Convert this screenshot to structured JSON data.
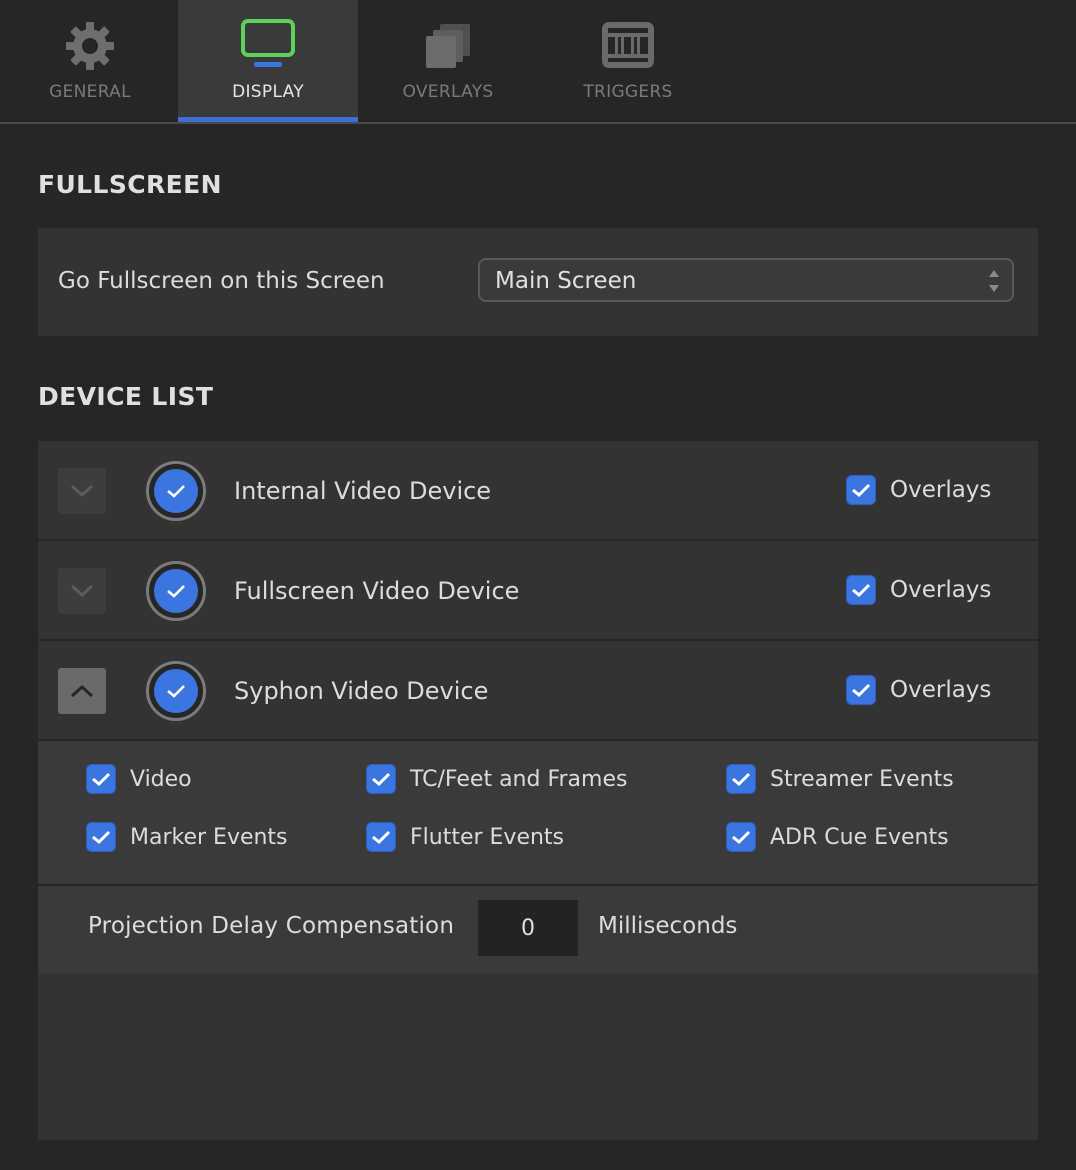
{
  "tabs": [
    {
      "label": "GENERAL",
      "icon": "gear-icon"
    },
    {
      "label": "DISPLAY",
      "icon": "monitor-icon",
      "active": true
    },
    {
      "label": "OVERLAYS",
      "icon": "layers-icon"
    },
    {
      "label": "TRIGGERS",
      "icon": "midi-icon"
    }
  ],
  "fullscreen": {
    "title": "FULLSCREEN",
    "label": "Go Fullscreen on this Screen",
    "selected_screen": "Main Screen"
  },
  "device_list": {
    "title": "DEVICE LIST",
    "devices": [
      {
        "name": "Internal Video Device",
        "enabled": true,
        "overlays_label": "Overlays",
        "overlays": true,
        "expanded": false
      },
      {
        "name": "Fullscreen Video Device",
        "enabled": true,
        "overlays_label": "Overlays",
        "overlays": true,
        "expanded": false
      },
      {
        "name": "Syphon Video Device",
        "enabled": true,
        "overlays_label": "Overlays",
        "overlays": true,
        "expanded": true
      }
    ]
  },
  "syphon_options": {
    "items": [
      {
        "label": "Video",
        "checked": true
      },
      {
        "label": "TC/Feet and Frames",
        "checked": true
      },
      {
        "label": "Streamer Events",
        "checked": true
      },
      {
        "label": "Marker Events",
        "checked": true
      },
      {
        "label": "Flutter Events",
        "checked": true
      },
      {
        "label": "ADR Cue Events",
        "checked": true
      }
    ],
    "delay_label": "Projection Delay Compensation",
    "delay_value": "0",
    "delay_unit": "Milliseconds"
  },
  "colors": {
    "accent": "#3b75e0",
    "tab_underline": "#3d6fd6",
    "monitor_icon_green": "#5ed15a",
    "background": "#262626",
    "panel": "#333333"
  }
}
